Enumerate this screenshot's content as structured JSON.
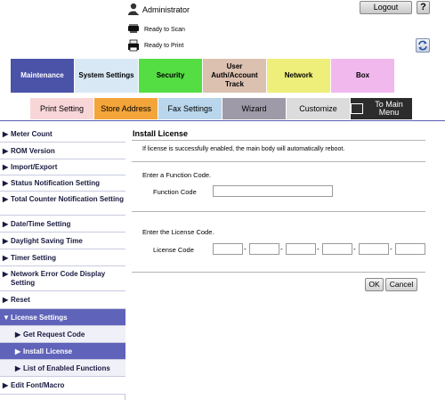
{
  "header": {
    "user_name": "Administrator",
    "logout_label": "Logout",
    "help_label": "?",
    "status_scan": "Ready to Scan",
    "status_print": "Ready to Print"
  },
  "tabs": [
    {
      "label": "Maintenance"
    },
    {
      "label": "System Settings"
    },
    {
      "label": "Security"
    },
    {
      "label": "User Auth/Account Track"
    },
    {
      "label": "Network"
    },
    {
      "label": "Box"
    }
  ],
  "subtabs": [
    {
      "label": "Print Setting"
    },
    {
      "label": "Store Address"
    },
    {
      "label": "Fax Settings"
    },
    {
      "label": "Wizard"
    },
    {
      "label": "Customize"
    },
    {
      "label": "To Main Menu"
    }
  ],
  "sidebar": {
    "items": [
      {
        "label": "Meter Count"
      },
      {
        "label": "ROM Version"
      },
      {
        "label": "Import/Export"
      },
      {
        "label": "Status Notification Setting"
      },
      {
        "label": "Total Counter Notification Setting"
      },
      {
        "label": "Date/Time Setting"
      },
      {
        "label": "Daylight Saving Time"
      },
      {
        "label": "Timer Setting"
      },
      {
        "label": "Network Error Code Display Setting"
      },
      {
        "label": "Reset"
      },
      {
        "label": "License Settings"
      },
      {
        "label": "Get Request Code"
      },
      {
        "label": "Install License"
      },
      {
        "label": "List of Enabled Functions"
      },
      {
        "label": "Edit Font/Macro"
      }
    ]
  },
  "main": {
    "title": "Install License",
    "note": "If license is successfully enabled, the main body will automatically reboot.",
    "function_prompt": "Enter a Function Code.",
    "function_label": "Function Code",
    "function_value": "",
    "license_prompt": "Enter the License Code.",
    "license_label": "License Code",
    "license_parts": [
      "",
      "",
      "",
      "",
      "",
      ""
    ],
    "dash": "-",
    "ok_label": "OK",
    "cancel_label": "Cancel"
  },
  "colors": {
    "accent": "#5f63b9",
    "tab_maintenance": "#4a53a8"
  }
}
